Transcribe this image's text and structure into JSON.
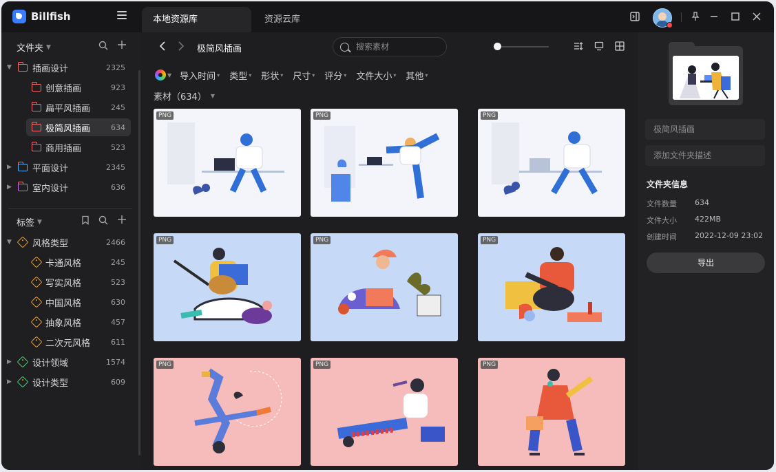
{
  "app": {
    "name": "Billfish"
  },
  "tabs": [
    {
      "label": "本地资源库",
      "active": true
    },
    {
      "label": "资源云库",
      "active": false
    }
  ],
  "sidebar": {
    "folders_title": "文件夹",
    "folders": [
      {
        "label": "插画设计",
        "count": "2325",
        "expanded": true,
        "color": "#ff6b6b"
      },
      {
        "label": "创意插画",
        "count": "923",
        "child": true
      },
      {
        "label": "扁平风插画",
        "count": "245",
        "child": true
      },
      {
        "label": "极简风插画",
        "count": "634",
        "child": true,
        "selected": true
      },
      {
        "label": "商用插画",
        "count": "523",
        "child": true
      },
      {
        "label": "平面设计",
        "count": "2345",
        "color": "#4fb3ff"
      },
      {
        "label": "室内设计",
        "count": "636",
        "color": "#c86bff"
      }
    ],
    "tags_title": "标签",
    "tags": [
      {
        "label": "风格类型",
        "count": "2466",
        "expanded": true,
        "color": "#f0a030"
      },
      {
        "label": "卡通风格",
        "count": "245",
        "child": true
      },
      {
        "label": "写实风格",
        "count": "523",
        "child": true
      },
      {
        "label": "中国风格",
        "count": "630",
        "child": true
      },
      {
        "label": "抽象风格",
        "count": "457",
        "child": true
      },
      {
        "label": "二次元风格",
        "count": "611",
        "child": true
      },
      {
        "label": "设计领域",
        "count": "1574",
        "color": "#4bd37b"
      },
      {
        "label": "设计类型",
        "count": "609",
        "color": "#4bd37b"
      }
    ]
  },
  "toolbar": {
    "breadcrumb": "极简风插画",
    "search_placeholder": "搜索素材",
    "filters": [
      "导入时间",
      "类型",
      "形状",
      "尺寸",
      "评分",
      "文件大小",
      "其他"
    ],
    "count_label": "素材（634）"
  },
  "grid": {
    "badge": "PNG",
    "rows": [
      {
        "bg": "#f3f5fa"
      },
      {
        "bg": "#c6d9f7"
      },
      {
        "bg": "#f6bcbc"
      }
    ]
  },
  "right_panel": {
    "folder_name": "极简风插画",
    "desc_placeholder": "添加文件夹描述",
    "info_title": "文件夹信息",
    "info": [
      {
        "label": "文件数量",
        "value": "634"
      },
      {
        "label": "文件大小",
        "value": "422MB"
      },
      {
        "label": "创建时间",
        "value": "2022-12-09 23:02"
      }
    ],
    "export_label": "导出"
  }
}
